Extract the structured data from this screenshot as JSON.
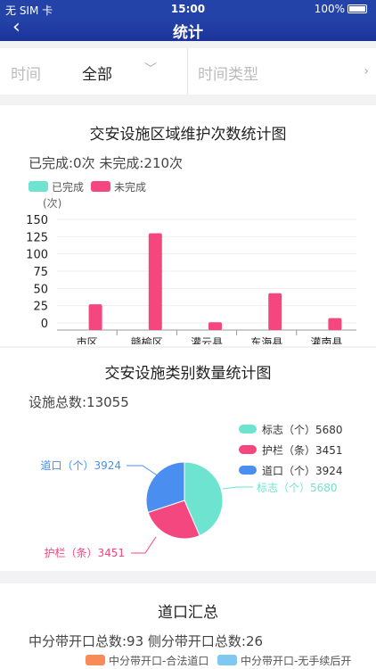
{
  "status": {
    "carrier": "无 SIM 卡",
    "time": "15:00",
    "battery": "100%"
  },
  "nav": {
    "title": "统计",
    "back": "‹"
  },
  "filter": {
    "time_label": "时间",
    "time_value": "全部",
    "type_label": "时间类型"
  },
  "card1": {
    "title": "交安设施区域维护次数统计图",
    "summary": "已完成:0次  未完成:210次",
    "legend_done": "已完成",
    "legend_undone": "未完成",
    "unit": "(次)"
  },
  "card2": {
    "title": "交安设施类别数量统计图",
    "summary": "设施总数:13055"
  },
  "card3": {
    "title": "道口汇总",
    "summary": "中分带开口总数:93  侧分带开口总数:26",
    "legend_a": "中分带开口-合法道口",
    "legend_b": "中分带开口-无手续后开"
  },
  "colors": {
    "done": "#6ee3cf",
    "undone": "#f5477f",
    "brand": "#2443a8"
  },
  "chart_data": [
    {
      "type": "bar",
      "title": "交安设施区域维护次数统计图",
      "ylabel": "(次)",
      "categories": [
        "市区",
        "赣榆区",
        "灌云县",
        "东海县",
        "灌南县"
      ],
      "series": [
        {
          "name": "已完成",
          "values": [
            0,
            0,
            0,
            0,
            0
          ]
        },
        {
          "name": "未完成",
          "values": [
            27,
            130,
            1,
            43,
            7
          ]
        }
      ],
      "ylim": [
        0,
        150
      ],
      "yticks": [
        0,
        25,
        50,
        75,
        100,
        125,
        150
      ]
    },
    {
      "type": "pie",
      "title": "交安设施类别数量统计图",
      "slices": [
        {
          "label": "标志（个）",
          "value": 5680,
          "color": "#6ee3cf"
        },
        {
          "label": "护栏（条）",
          "value": 3451,
          "color": "#f5477f"
        },
        {
          "label": "道口（个）",
          "value": 3924,
          "color": "#4a8ff0"
        }
      ]
    }
  ]
}
